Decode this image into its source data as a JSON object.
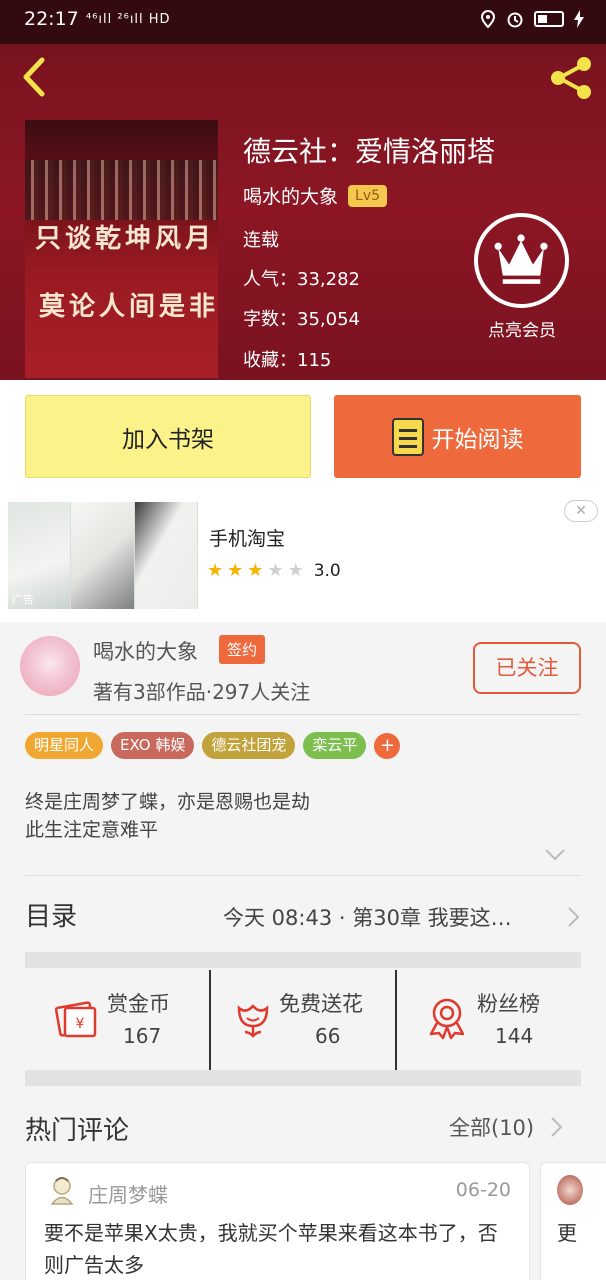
{
  "status_bar": {
    "time": "22:17",
    "signal": "⁴⁶ıll ²⁶ıll HD",
    "icons": [
      "location-icon",
      "alarm-icon",
      "battery-icon",
      "charging-icon"
    ]
  },
  "book": {
    "title": "德云社：爱情洛丽塔",
    "author": "喝水的大象",
    "level": "Lv5",
    "status": "连载",
    "popularity": "人气：33,282",
    "words": "字数：35,054",
    "favorites": "收藏：115",
    "cover_line1": "只谈乾坤风月",
    "cover_line2": "莫论人间是非"
  },
  "vip": {
    "label": "点亮会员"
  },
  "actions": {
    "add_shelf": "加入书架",
    "start_reading": "开始阅读"
  },
  "ad": {
    "tag": "广告",
    "title": "手机淘宝",
    "rating": 3,
    "max_rating": 5,
    "score": "3.0",
    "close": "✕"
  },
  "author_card": {
    "name": "喝水的大象",
    "badge": "签约",
    "sub": "著有3部作品·297人关注",
    "follow_label": "已关注"
  },
  "tags": [
    {
      "label": "明星同人",
      "color": "#f0a832"
    },
    {
      "label": "EXO 韩娱",
      "color": "#c9685c"
    },
    {
      "label": "德云社团宠",
      "color": "#c2a23a"
    },
    {
      "label": "栾云平",
      "color": "#7cbf4e"
    }
  ],
  "tag_add": "+",
  "description": {
    "line1": "终是庄周梦了蝶，亦是恩赐也是劫",
    "line2": "此生注定意难平"
  },
  "toc": {
    "title": "目录",
    "info": "今天 08:43 · 第30章  我要这…"
  },
  "stats": [
    {
      "label": "赏金币",
      "value": "167"
    },
    {
      "label": "免费送花",
      "value": "66"
    },
    {
      "label": "粉丝榜",
      "value": "144"
    }
  ],
  "comments_section": {
    "title": "热门评论",
    "all_label": "全部(10)"
  },
  "comments": [
    {
      "user": "庄周梦蝶",
      "date": "06-20",
      "text": "要不是苹果X太贵，我就买个苹果来看这本书了，否则广告太多"
    },
    {
      "text": "更"
    }
  ],
  "colors": {
    "header": "#8c1624",
    "accent": "#ee6a3c",
    "shelf_btn": "#fbf38a"
  }
}
